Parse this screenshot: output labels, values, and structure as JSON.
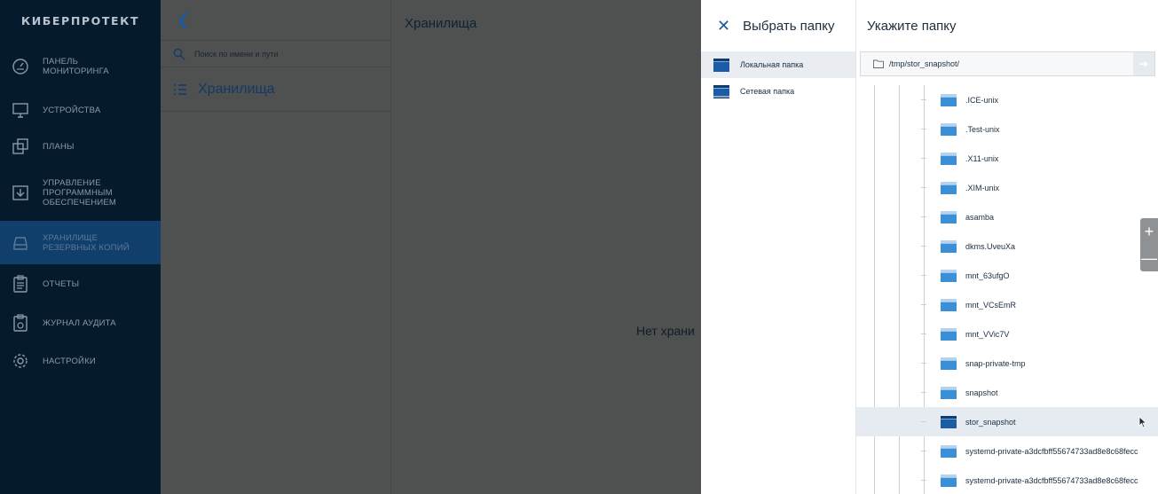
{
  "sidebar": {
    "logo": "КИБЕРПРОТЕКТ",
    "items": [
      {
        "label": "ПАНЕЛЬ\nМОНИТОРИНГА",
        "icon": "dashboard-icon"
      },
      {
        "label": "УСТРОЙСТВА",
        "icon": "devices-icon"
      },
      {
        "label": "ПЛАНЫ",
        "icon": "plans-icon"
      },
      {
        "label": "УПРАВЛЕНИЕ\nПРОГРАММНЫМ\nОБЕСПЕЧЕНИЕМ",
        "icon": "software-icon"
      },
      {
        "label": "ХРАНИЛИЩЕ\nРЕЗЕРВНЫХ КОПИЙ",
        "icon": "storage-icon"
      },
      {
        "label": "ОТЧЕТЫ",
        "icon": "reports-icon"
      },
      {
        "label": "ЖУРНАЛ АУДИТА",
        "icon": "audit-icon"
      },
      {
        "label": "НАСТРОЙКИ",
        "icon": "settings-icon"
      }
    ]
  },
  "middle": {
    "search_placeholder": "Поиск по имени и пути",
    "list_item": "Хранилища"
  },
  "content": {
    "title": "Хранилища",
    "empty_text": "Нет храни"
  },
  "choose_panel": {
    "title": "Выбрать папку",
    "sources": [
      "Локальная папка",
      "Сетевая папка"
    ]
  },
  "browser": {
    "title": "Укажите папку",
    "path": "/tmp/stor_snapshot/",
    "folders": [
      ".ICE-unix",
      ".Test-unix",
      ".X11-unix",
      ".XIM-unix",
      "asamba",
      "dkms.UveuXa",
      "mnt_63ufgO",
      "mnt_VCsEmR",
      "mnt_VVic7V",
      "snap-private-tmp",
      "snapshot",
      "stor_snapshot",
      "systemd-private-a3dcfbff55674733ad8e8c68fecc",
      "systemd-private-a3dcfbff55674733ad8e8c68fecc"
    ],
    "selected": "stor_snapshot"
  },
  "colors": {
    "sidebar_bg": "#061a2e",
    "active_nav": "#103f6b",
    "accent": "#1d59a0",
    "overlay": "#4f5050"
  }
}
